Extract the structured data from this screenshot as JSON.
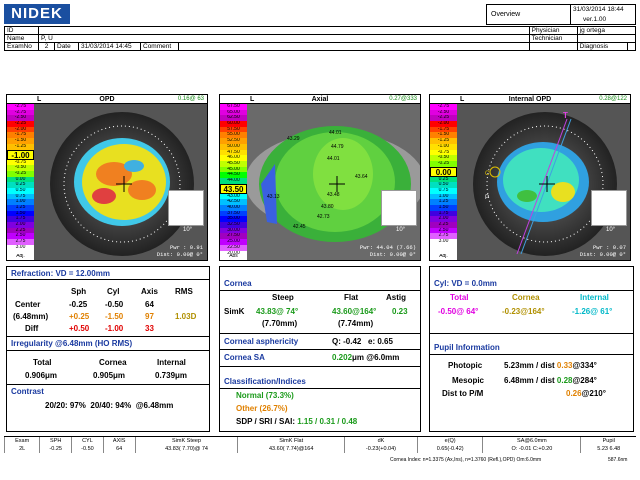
{
  "header": {
    "logo": "NIDEK",
    "view": "Overview",
    "datetime": "31/03/2014 18:44",
    "version": "ver.1.00",
    "id_label": "ID",
    "name_label": "Name",
    "name_value": "P, U",
    "examno_label": "ExamNo",
    "examno_value": "2",
    "date_label": "Date",
    "date_value": "31/03/2014 14:45",
    "comment_label": "Comment",
    "physician_label": "Physician",
    "physician_value": "jg ortega",
    "technician_label": "Technician",
    "diagnosis_label": "Diagnosis"
  },
  "maps": [
    {
      "eye": "L",
      "title": "OPD",
      "value": "0.16@ 63",
      "scale": [
        "-2.75",
        "-2.75",
        "-2.50",
        "-2.25",
        "-2.00",
        "-1.75",
        "-1.50",
        "-1.25",
        "-1.00",
        "-0.75",
        "-0.50",
        "-0.25",
        "0.00",
        "0.25",
        "0.50",
        "0.75",
        "1.00",
        "1.25",
        "1.50",
        "1.75",
        "2.00",
        "2.25",
        "2.50",
        "2.75",
        "3.00"
      ],
      "scale_hl": "-1.00",
      "scale_hl_index": 8,
      "footer1": "Adj.",
      "footer2": "Com 25",
      "pwr1": "Pwr :    0.91",
      "pwr2": "Dist:  0.00@  0°",
      "inset_label": "10°",
      "colors": {
        "center": "#e8c020",
        "mid": "#e0e020",
        "outer": "#40c0e0"
      }
    },
    {
      "eye": "L",
      "title": "Axial",
      "value": "0.27@333",
      "scale": [
        "67.50",
        "65.00",
        "62.50",
        "60.00",
        "57.50",
        "55.00",
        "52.50",
        "50.00",
        "47.50",
        "46.00",
        "45.50",
        "45.00",
        "44.50",
        "44.00",
        "43.50",
        "43.00",
        "42.50",
        "40.00",
        "37.50",
        "35.00",
        "32.50",
        "30.00",
        "27.50",
        "25.00",
        "22.50",
        "20.00"
      ],
      "scale_hl": "43.50",
      "scale_hl_index": 14,
      "footer1": "Abs",
      "footer2": "S-K 1.5",
      "pwr1": "Pwr:  44.04 (7.66)",
      "pwr2": "Dist:  0.00@  0°",
      "inset_label": "10°",
      "numbers": [
        "44.01",
        "43.29",
        "44.79",
        "44.01",
        "43.64",
        "43.13",
        "43.48",
        "43.80",
        "42.73",
        "42.45"
      ]
    },
    {
      "eye": "L",
      "title": "Internal OPD",
      "value": "0.28@122",
      "scale": [
        "-2.75",
        "-2.50",
        "-2.25",
        "-2.00",
        "-1.75",
        "-1.50",
        "-1.25",
        "-1.00",
        "-0.75",
        "-0.50",
        "-0.25",
        "0.00",
        "0.25",
        "0.50",
        "0.75",
        "1.00",
        "1.25",
        "1.50",
        "1.75",
        "2.00",
        "2.25",
        "2.50",
        "2.75",
        "3.00"
      ],
      "scale_hl": "0.00",
      "scale_hl_index": 11,
      "footer1": "Adj.",
      "footer2": "Com 25",
      "pwr1": "Pwr :    0.07",
      "pwr2": "Dist:  0.00@  0°",
      "inset_label": "10°",
      "marker_t": "T",
      "marker_c": "C",
      "marker_p": "P"
    }
  ],
  "refraction": {
    "title": "Refraction: VD = 12.00mm",
    "col_sph": "Sph",
    "col_cyl": "Cyl",
    "col_axis": "Axis",
    "col_rms": "RMS",
    "center_label": "Center",
    "center_sph": "-0.25",
    "center_cyl": "-0.50",
    "center_axis": "64",
    "zone_label": "(6.48mm)",
    "zone_sph": "+0.25",
    "zone_cyl": "-1.50",
    "zone_axis": "97",
    "zone_rms": "1.03D",
    "diff_label": "Diff",
    "diff_sph": "+0.50",
    "diff_cyl": "-1.00",
    "diff_axis": "33"
  },
  "irregularity": {
    "title": "Irregularity @6.48mm (HO RMS)",
    "total_label": "Total",
    "cornea_label": "Cornea",
    "internal_label": "Internal",
    "total_value": "0.906μm",
    "cornea_value": "0.905μm",
    "internal_value": "0.739μm"
  },
  "contrast": {
    "title": "Contrast",
    "value": "20/20: 97%  20/40: 94%  @6.48mm"
  },
  "cornea": {
    "title": "Cornea",
    "col_steep": "Steep",
    "col_flat": "Flat",
    "col_astig": "Astig",
    "simk_label": "SimK",
    "steep": "43.83@ 74°",
    "steep_r": "(7.70mm)",
    "flat": "43.60@164°",
    "flat_r": "(7.74mm)",
    "astig": "0.23",
    "asph_title": "Corneal asphericity",
    "asph_value": "Q: -0.42   e: 0.65",
    "sa_title": "Cornea SA",
    "sa_value": "0.202",
    "sa_unit": "μm @6.0mm",
    "class_title": "Classification/Indices",
    "normal": "Normal (73.3%)",
    "other": "Other (26.7%)",
    "sdp_label": "SDP / SRI / SAI: ",
    "sdp_values": "1.15 / 0.31 / 0.48"
  },
  "cyl": {
    "title": "Cyl: VD = 0.0mm",
    "total_label": "Total",
    "cornea_label": "Cornea",
    "internal_label": "Internal",
    "total": "-0.50@ 64°",
    "cornea": "-0.23@164°",
    "internal": "-1.26@ 61°"
  },
  "pupil": {
    "title": "Pupil Information",
    "photopic_label": "Photopic",
    "photopic_val": "5.23mm / dist ",
    "photopic_dist": "0.33",
    "photopic_ang": "@334°",
    "mesopic_label": "Mesopic",
    "mesopic_val": "6.48mm / dist ",
    "mesopic_dist": "0.28",
    "mesopic_ang": "@284°",
    "dist_label": "Dist to P/M",
    "dist_val": "0.26",
    "dist_ang": "@210°"
  },
  "bottom": {
    "headers": [
      "Exam",
      "SPH",
      "CYL",
      "AXIS",
      "SimK Steep",
      "SimK Flat",
      "dK",
      "e(Q)",
      "SA@6.0mm",
      "Pupil"
    ],
    "values": [
      "2L",
      "-0.25",
      "-0.50",
      "64",
      "43.83( 7.70)@ 74",
      "43.60( 7.74)@164",
      "-0.23(+0.04)",
      "0.65(-0.42)",
      "O: -0.01  C:+0.20",
      "5.23   6.48"
    ],
    "foot1": "Cornea Index: n=1.3375 (Ax,Ins), n=1.3760 (Refl.),OPD) Om:6.0mm",
    "foot2": "587.6nm"
  }
}
